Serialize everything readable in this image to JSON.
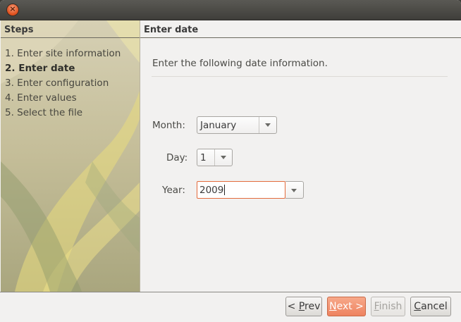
{
  "window": {
    "close_glyph": "×"
  },
  "steps": {
    "title": "Steps",
    "items": [
      {
        "label": "1. Enter site information",
        "active": false
      },
      {
        "label": "2. Enter date",
        "active": true
      },
      {
        "label": "3. Enter configuration",
        "active": false
      },
      {
        "label": "4. Enter values",
        "active": false
      },
      {
        "label": "5. Select the file",
        "active": false
      }
    ]
  },
  "content": {
    "title": "Enter date",
    "instruction": "Enter the following date information.",
    "month": {
      "label": "Month:",
      "value": "January"
    },
    "day": {
      "label": "Day:",
      "value": "1"
    },
    "year": {
      "label": "Year:",
      "value": "2009"
    }
  },
  "buttons": {
    "prev": {
      "prefix": "< ",
      "mnemonic": "P",
      "rest": "rev"
    },
    "next": {
      "mnemonic": "N",
      "rest": "ext >"
    },
    "finish": {
      "mnemonic": "F",
      "rest": "inish"
    },
    "cancel": {
      "mnemonic": "C",
      "rest": "ancel"
    }
  },
  "colors": {
    "accent": "#ee8360",
    "focus_border": "#e36b3c",
    "steps_panel_bg": "#c7c19f"
  }
}
